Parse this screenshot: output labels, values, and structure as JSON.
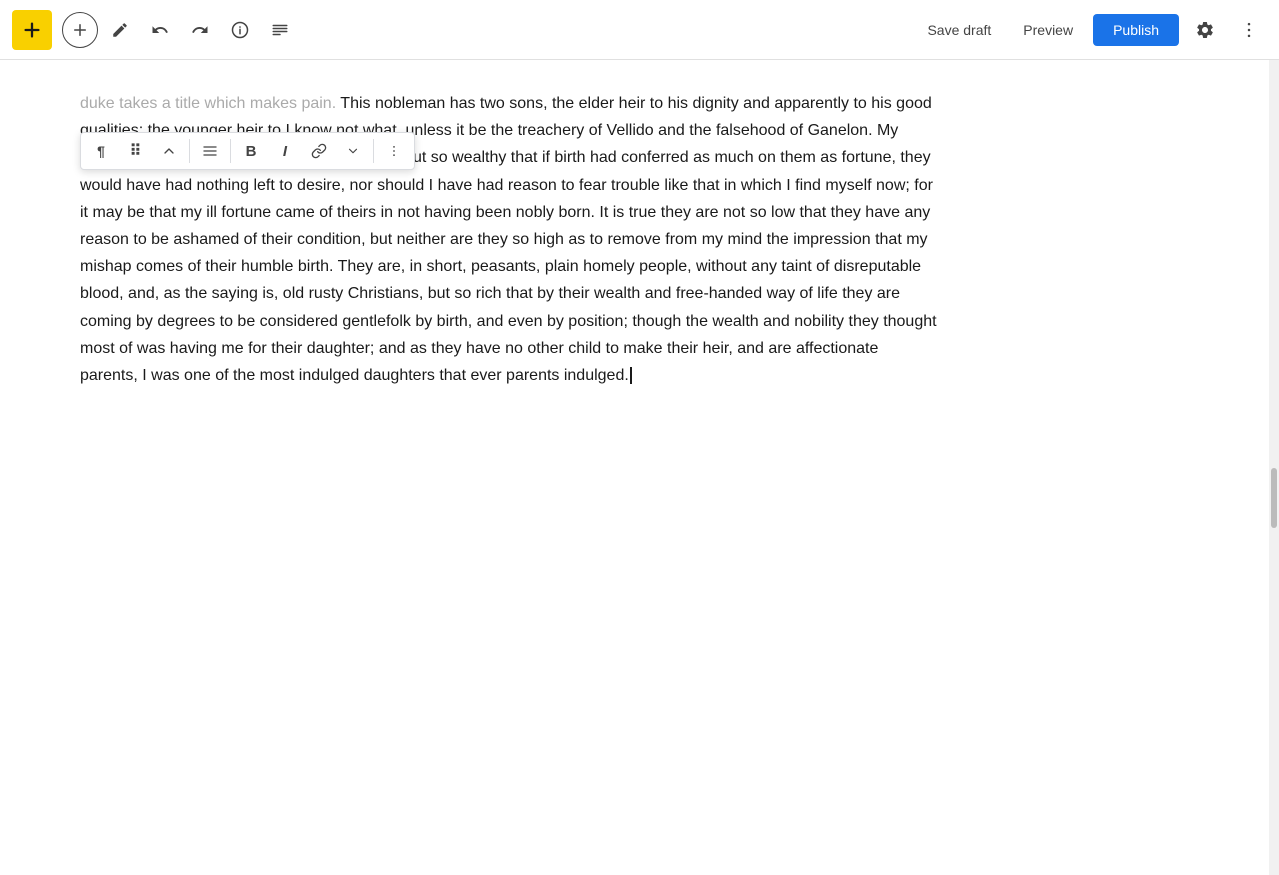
{
  "toolbar": {
    "logo_icon": "plus-icon",
    "add_label": "+",
    "edit_icon": "edit-icon",
    "undo_icon": "undo-icon",
    "redo_icon": "redo-icon",
    "info_icon": "info-icon",
    "list_icon": "list-icon",
    "save_draft_label": "Save draft",
    "preview_label": "Preview",
    "publish_label": "Publish",
    "settings_icon": "settings-icon",
    "more_icon": "more-icon"
  },
  "block_toolbar": {
    "paragraph_icon": "¶",
    "drag_icon": "⠿",
    "move_icon": "⌃",
    "align_icon": "≡",
    "bold_icon": "B",
    "italic_icon": "I",
    "link_icon": "🔗",
    "dropdown_icon": "⌄",
    "more_icon": "⋮"
  },
  "article": {
    "text_part1": "duke takes a title which makes pain. This nobleman has two sons, the elder heir to his dignity and apparently to his good qualities; the younger heir to I know not what, unless it be the treachery of Vellido and the falsehood of Ganelon. My parents are this lord's vassals, lowly in origin, but so wealthy that if birth had conferred as much on them as fortune, they would have had nothing left to desire, nor should I have had reason to fear trouble like that in which I find myself now; for it may be that my ill fortune came of theirs in not having been nobly born. It is true they are not so low that they have any reason to be ashamed of their condition, but neither are they so high as to remove from my mind the impression that my mishap comes of their humble birth. They are, in short, peasants, plain homely people, without any taint of disreputable blood, and, as the saying is, old rusty Christians, but so rich that by their wealth and free-handed way of life they are coming by degrees to be considered gentlefolk by birth, and even by position; though the wealth and nobility they thought most of was having me for their daughter; and as they have no other child to make their heir, and are affectionate parents, I was one of the most indulged daughters that ever parents indulged."
  }
}
